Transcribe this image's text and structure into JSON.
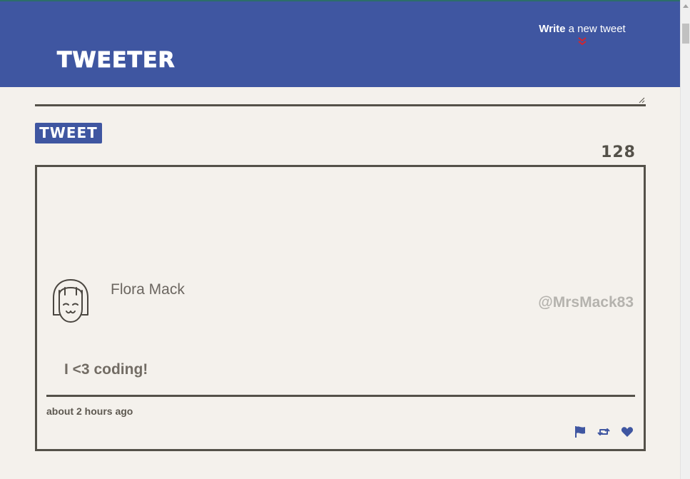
{
  "header": {
    "brand": "TWEETER",
    "compose_toggle": {
      "bold_word": "Write",
      "rest": " a new tweet",
      "icon": "double-chevron-down-icon"
    }
  },
  "compose": {
    "textarea_value": "",
    "button_label": "TWEET",
    "char_counter": "128"
  },
  "tweet": {
    "avatar_icon": "girl-avatar-icon",
    "author_name": "Flora Mack",
    "author_handle": "@MrsMack83",
    "content": "I <3 coding!",
    "timestamp": "about 2 hours ago",
    "actions": [
      {
        "name": "flag",
        "icon": "flag-icon"
      },
      {
        "name": "retweet",
        "icon": "retweet-icon"
      },
      {
        "name": "like",
        "icon": "heart-icon"
      }
    ]
  },
  "colors": {
    "header_bg": "#3f56a1",
    "page_bg": "#f4f1ec",
    "border": "#545149",
    "chevron": "#d3262e",
    "handle": "#b5b3ae"
  }
}
